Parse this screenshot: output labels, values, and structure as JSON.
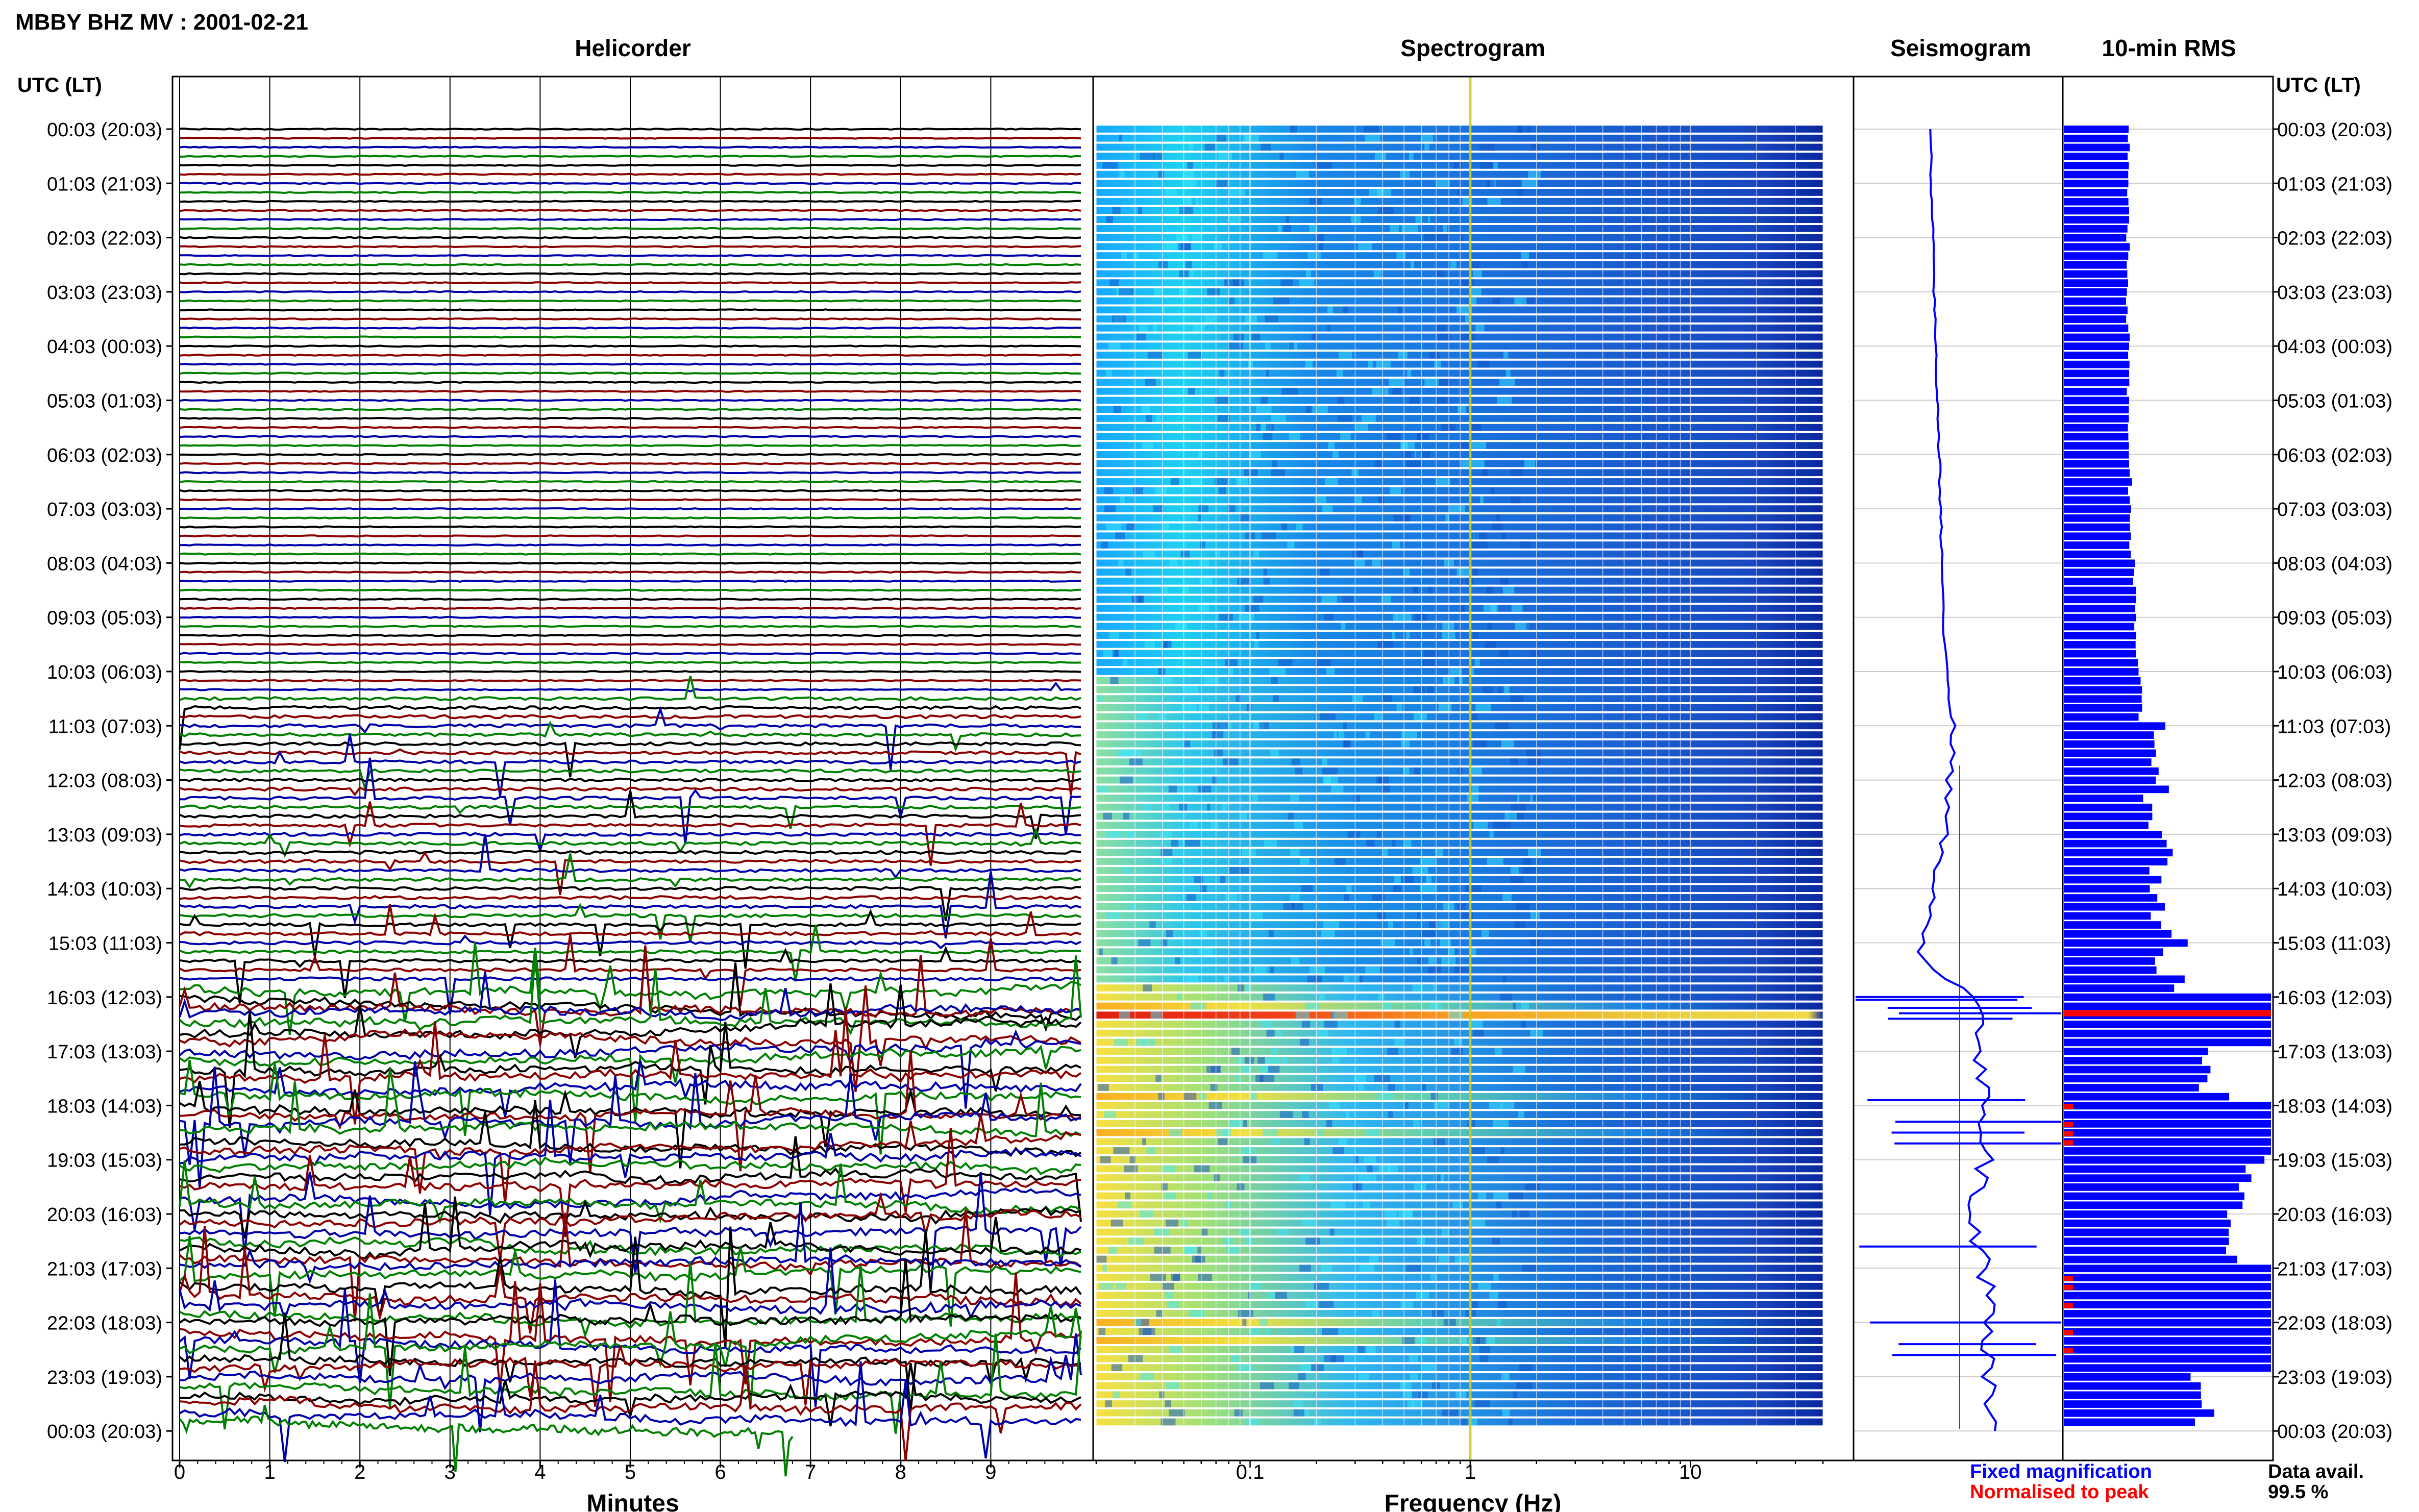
{
  "figure": {
    "title": "MBBY BHZ MV : 2001-02-21",
    "utc_header_left": "UTC (LT)",
    "utc_header_right": "UTC (LT)",
    "data_avail_label": "Data avail.",
    "data_avail_value": "99.5 %",
    "legend_fixed": "Fixed magnification",
    "legend_normalised": "Normalised to peak"
  },
  "colors": {
    "trace": [
      "#000000",
      "#8b0000",
      "#0000aa",
      "#008000"
    ],
    "seismo_fixed": "#0000ff",
    "seismo_norm": "#ff0000",
    "rms_bar": "#0000ff",
    "rms_peak": "#ff0000",
    "grid": "#000000",
    "spectro_grid": "#ffffff",
    "spectro_marker": "#c8c800"
  },
  "chart_data": [
    {
      "type": "line",
      "title": "Helicorder",
      "xlabel": "Minutes",
      "ylabel": "",
      "xlim": [
        0,
        10
      ],
      "x_ticks": [
        "0",
        "1",
        "2",
        "3",
        "4",
        "5",
        "6",
        "7",
        "8",
        "9"
      ],
      "rows_per_hour": 6,
      "hours": 24,
      "hour_labels": [
        "00:03 (20:03)",
        "01:03 (21:03)",
        "02:03 (22:03)",
        "03:03 (23:03)",
        "04:03 (00:03)",
        "05:03 (01:03)",
        "06:03 (02:03)",
        "07:03 (03:03)",
        "08:03 (04:03)",
        "09:03 (05:03)",
        "10:03 (06:03)",
        "11:03 (07:03)",
        "12:03 (08:03)",
        "13:03 (09:03)",
        "14:03 (10:03)",
        "15:03 (11:03)",
        "16:03 (12:03)",
        "17:03 (13:03)",
        "18:03 (14:03)",
        "19:03 (15:03)",
        "20:03 (16:03)",
        "21:03 (17:03)",
        "22:03 (18:03)",
        "23:03 (19:03)",
        "00:03 (20:03)"
      ],
      "last_row_end_minute": 6.8
    },
    {
      "type": "heatmap",
      "title": "Spectrogram",
      "xlabel": "Frequency (Hz)",
      "ylabel": "",
      "xscale": "log",
      "xlim": [
        0.02,
        40
      ],
      "x_ticks": [
        "0.1",
        "1",
        "10"
      ],
      "x_tick_values": [
        0.1,
        1,
        10
      ],
      "marker_frequency_hz": 1,
      "colormap": "jet",
      "intense_bands_utc_hour": [
        16.1,
        16.3,
        17.9,
        18.5,
        22.0,
        22.4
      ]
    },
    {
      "type": "line",
      "title": "Seismogram",
      "xlabel": "",
      "ylabel": "",
      "x_ticks": []
    },
    {
      "type": "bar",
      "title": "10-min RMS",
      "xlabel": "",
      "ylabel": "",
      "x_ticks": [],
      "xlim": [
        0,
        1
      ],
      "hour_labels": [
        "00:03 (20:03)",
        "01:03 (21:03)",
        "02:03 (22:03)",
        "03:03 (23:03)",
        "04:03 (00:03)",
        "05:03 (01:03)",
        "06:03 (02:03)",
        "07:03 (03:03)",
        "08:03 (04:03)",
        "09:03 (05:03)",
        "10:03 (06:03)",
        "11:03 (07:03)",
        "12:03 (08:03)",
        "13:03 (09:03)",
        "14:03 (10:03)",
        "15:03 (11:03)",
        "16:03 (12:03)",
        "17:03 (13:03)",
        "18:03 (14:03)",
        "19:03 (15:03)",
        "20:03 (16:03)",
        "21:03 (17:03)",
        "22:03 (18:03)",
        "23:03 (19:03)",
        "00:03 (20:03)"
      ],
      "hourly_rms_fraction": [
        0.31,
        0.31,
        0.31,
        0.31,
        0.31,
        0.31,
        0.32,
        0.32,
        0.34,
        0.35,
        0.37,
        0.45,
        0.45,
        0.45,
        0.45,
        0.52,
        1.0,
        0.72,
        1.0,
        0.9,
        0.85,
        1.0,
        1.0,
        0.65
      ]
    }
  ]
}
